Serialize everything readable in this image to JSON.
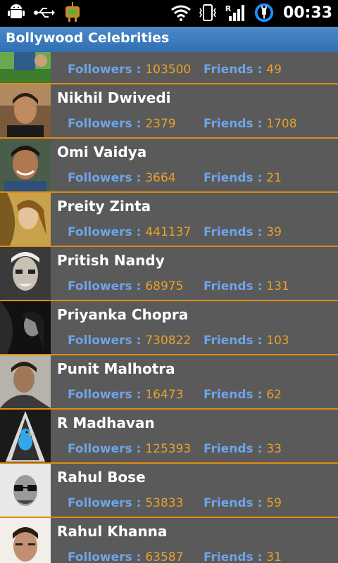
{
  "status": {
    "time": "00:33",
    "network_letter": "R"
  },
  "app": {
    "title": "Bollywood Celebrities"
  },
  "labels": {
    "followers": "Followers : ",
    "friends": "Friends : "
  },
  "celebrities": [
    {
      "name": "",
      "followers": "103500",
      "friends": "49"
    },
    {
      "name": "Nikhil Dwivedi",
      "followers": "2379",
      "friends": "1708"
    },
    {
      "name": "Omi Vaidya",
      "followers": "3664",
      "friends": "21"
    },
    {
      "name": "Preity Zinta",
      "followers": "441137",
      "friends": "39"
    },
    {
      "name": "Pritish Nandy",
      "followers": "68975",
      "friends": "131"
    },
    {
      "name": "Priyanka Chopra",
      "followers": "730822",
      "friends": "103"
    },
    {
      "name": "Punit Malhotra",
      "followers": "16473",
      "friends": "62"
    },
    {
      "name": "R Madhavan",
      "followers": "125393",
      "friends": "33"
    },
    {
      "name": "Rahul Bose",
      "followers": "53833",
      "friends": "59"
    },
    {
      "name": "Rahul Khanna",
      "followers": "63587",
      "friends": "31"
    }
  ]
}
